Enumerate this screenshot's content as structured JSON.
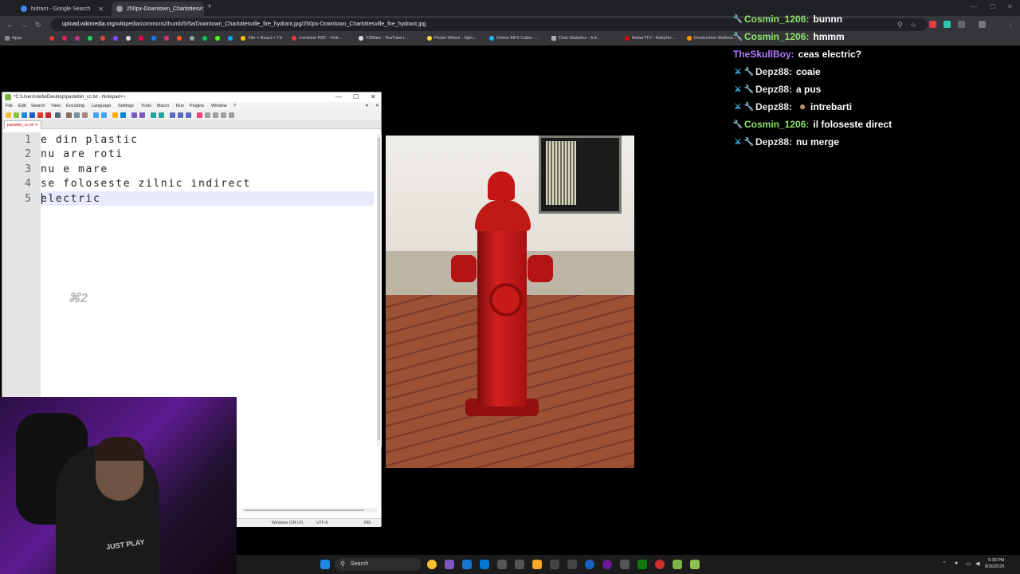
{
  "browser": {
    "tabs": [
      {
        "title": "hidrant - Google Search",
        "active": false,
        "icon_color": "#4285f4"
      },
      {
        "title": "250px-Downtown_Charlottesvi",
        "active": true,
        "icon_color": "#999999"
      }
    ],
    "new_tab_symbol": "+",
    "url_host": "upload.wikimedia.org",
    "url_path": "/wikipedia/commons/thumb/5/5a/Downtown_Charlottesville_fire_hydrant.jpg/250px-Downtown_Charlottesville_fire_hydrant.jpg",
    "bookmarks": [
      "Apps",
      "Vite + React + TS",
      "Combine PDF - Onli...",
      "Y2Mate - YouTube t...",
      "Picker Wheel - Spin...",
      "Online MP3 Cutter -...",
      "Chat Statistics - A K...",
      "BetterTTV - BabyHo...",
      "Destruction Wallock..."
    ]
  },
  "notepad": {
    "title": "*C:\\Users\\stefa\\Desktop\\pastebin_cc.txt - Notepad++",
    "menu": [
      "File",
      "Edit",
      "Search",
      "View",
      "Encoding",
      "Language",
      "Settings",
      "Tools",
      "Macro",
      "Run",
      "Plugins",
      "Window",
      "?"
    ],
    "file_tab": "pastebin_cc.txt",
    "lines": [
      {
        "num": "1",
        "text": "e din plastic"
      },
      {
        "num": "2",
        "text": "nu are roti"
      },
      {
        "num": "3",
        "text": "nu e mare"
      },
      {
        "num": "4",
        "text": "se foloseste zilnic indirect"
      },
      {
        "num": "5",
        "text": "electric"
      }
    ],
    "status": {
      "eol": "Windows (CR LF)",
      "encoding": "UTF-8",
      "mode": "INS"
    }
  },
  "chat": [
    {
      "user": "Cosmin_1206:",
      "text": "bunnn",
      "color": "#8ee36b",
      "badges": [
        "mod"
      ]
    },
    {
      "user": "Cosmin_1206:",
      "text": "hmmm",
      "color": "#8ee36b",
      "badges": [
        "mod"
      ]
    },
    {
      "user": "TheSkullBoy:",
      "text": "ceas electric?",
      "color": "#b57bff",
      "badges": []
    },
    {
      "user": "Depz88:",
      "text": "coaie",
      "color": "#e8e8e8",
      "badges": [
        "sword",
        "mod"
      ]
    },
    {
      "user": "Depz88:",
      "text": "a pus",
      "color": "#e8e8e8",
      "badges": [
        "sword",
        "mod"
      ]
    },
    {
      "user": "Depz88:",
      "text": "intrebarti",
      "color": "#e8e8e8",
      "badges": [
        "sword",
        "mod"
      ],
      "emote": "person-emote"
    },
    {
      "user": "Cosmin_1206:",
      "text": "il foloseste direct",
      "color": "#8ee36b",
      "badges": [
        "mod"
      ]
    },
    {
      "user": "Depz88:",
      "text": "nu merge",
      "color": "#e8e8e8",
      "badges": [
        "sword",
        "mod"
      ]
    }
  ],
  "taskbar": {
    "search_label": "Search",
    "time": "9:30 PM",
    "date": "8/30/2025"
  },
  "webcam": {
    "shirt_text": "JUST PLAY"
  },
  "colors": {
    "accent": "#1a73e8",
    "chat_green": "#8ee36b",
    "chat_purple": "#b57bff"
  }
}
